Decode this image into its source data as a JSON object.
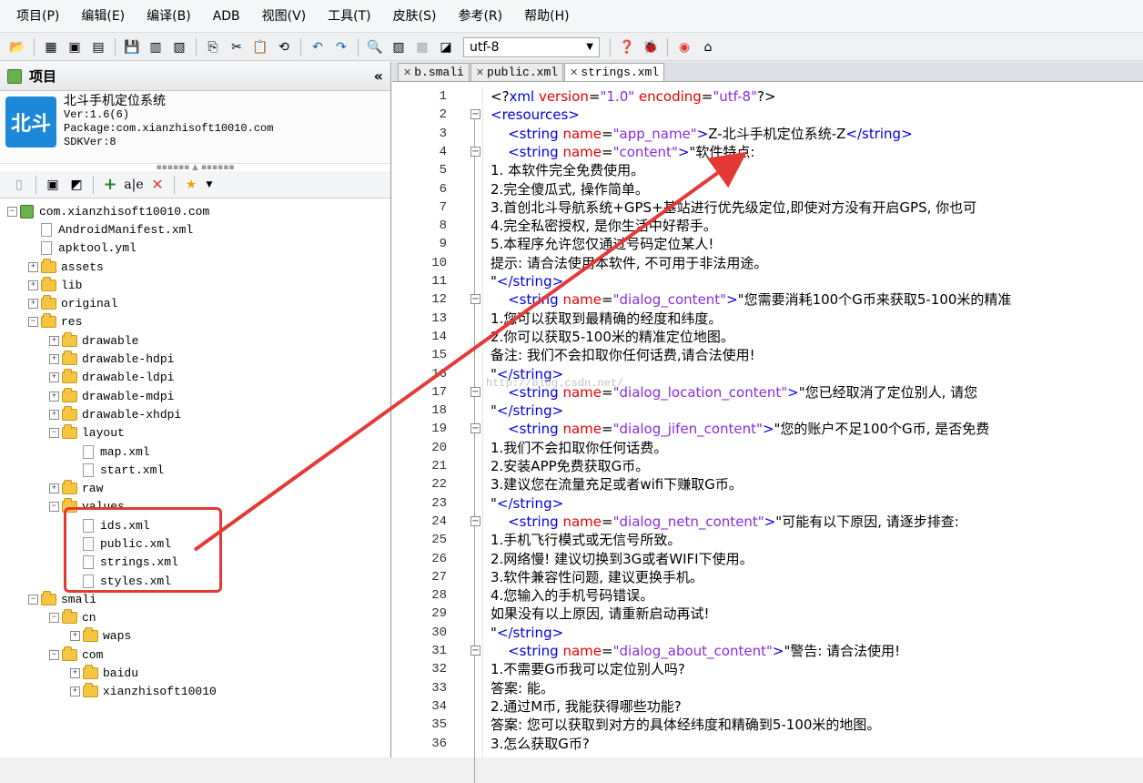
{
  "menu": [
    "项目(P)",
    "编辑(E)",
    "编译(B)",
    "ADB",
    "视图(V)",
    "工具(T)",
    "皮肤(S)",
    "参考(R)",
    "帮助(H)"
  ],
  "toolbar": {
    "encoding": "utf-8"
  },
  "project_panel": {
    "title": "项目",
    "collapse": "«",
    "logo_text": "北斗",
    "app_name": "北斗手机定位系统",
    "version": "Ver:1.6(6)",
    "package": "Package:com.xianzhisoft10010.com",
    "sdk": "SDKVer:8"
  },
  "tree": [
    {
      "label": "com.xianzhisoft10010.com",
      "type": "project",
      "indent": 0,
      "exp": "-"
    },
    {
      "label": "AndroidManifest.xml",
      "type": "file",
      "indent": 1,
      "exp": ""
    },
    {
      "label": "apktool.yml",
      "type": "file",
      "indent": 1,
      "exp": ""
    },
    {
      "label": "assets",
      "type": "folder",
      "indent": 1,
      "exp": "+"
    },
    {
      "label": "lib",
      "type": "folder",
      "indent": 1,
      "exp": "+"
    },
    {
      "label": "original",
      "type": "folder",
      "indent": 1,
      "exp": "+"
    },
    {
      "label": "res",
      "type": "folder",
      "indent": 1,
      "exp": "-"
    },
    {
      "label": "drawable",
      "type": "folder",
      "indent": 2,
      "exp": "+"
    },
    {
      "label": "drawable-hdpi",
      "type": "folder",
      "indent": 2,
      "exp": "+"
    },
    {
      "label": "drawable-ldpi",
      "type": "folder",
      "indent": 2,
      "exp": "+"
    },
    {
      "label": "drawable-mdpi",
      "type": "folder",
      "indent": 2,
      "exp": "+"
    },
    {
      "label": "drawable-xhdpi",
      "type": "folder",
      "indent": 2,
      "exp": "+"
    },
    {
      "label": "layout",
      "type": "folder",
      "indent": 2,
      "exp": "-"
    },
    {
      "label": "map.xml",
      "type": "file",
      "indent": 3,
      "exp": ""
    },
    {
      "label": "start.xml",
      "type": "file",
      "indent": 3,
      "exp": ""
    },
    {
      "label": "raw",
      "type": "folder",
      "indent": 2,
      "exp": "+"
    },
    {
      "label": "values",
      "type": "folder",
      "indent": 2,
      "exp": "-"
    },
    {
      "label": "ids.xml",
      "type": "file",
      "indent": 3,
      "exp": ""
    },
    {
      "label": "public.xml",
      "type": "file",
      "indent": 3,
      "exp": ""
    },
    {
      "label": "strings.xml",
      "type": "file",
      "indent": 3,
      "exp": ""
    },
    {
      "label": "styles.xml",
      "type": "file",
      "indent": 3,
      "exp": ""
    },
    {
      "label": "smali",
      "type": "folder",
      "indent": 1,
      "exp": "-"
    },
    {
      "label": "cn",
      "type": "folder",
      "indent": 2,
      "exp": "-"
    },
    {
      "label": "waps",
      "type": "folder",
      "indent": 3,
      "exp": "+"
    },
    {
      "label": "com",
      "type": "folder",
      "indent": 2,
      "exp": "-"
    },
    {
      "label": "baidu",
      "type": "folder",
      "indent": 3,
      "exp": "+"
    },
    {
      "label": "xianzhisoft10010",
      "type": "folder",
      "indent": 3,
      "exp": "+"
    }
  ],
  "tabs": [
    "b.smali",
    "public.xml",
    "strings.xml"
  ],
  "watermark": "http://blog.csdn.net/",
  "code_lines": [
    [
      [
        "",
        "<?"
      ],
      [
        "tag",
        "xml"
      ],
      [
        "attr",
        " version"
      ],
      [
        "",
        "="
      ],
      [
        "val",
        "\"1.0\""
      ],
      [
        "attr",
        " encoding"
      ],
      [
        "",
        "="
      ],
      [
        "val",
        "\"utf-8\""
      ],
      [
        "",
        "?>"
      ]
    ],
    [
      [
        "tag",
        "<resources>"
      ]
    ],
    [
      [
        "",
        "    "
      ],
      [
        "tag",
        "<string"
      ],
      [
        "attr",
        " name"
      ],
      [
        "",
        "="
      ],
      [
        "val",
        "\"app_name\""
      ],
      [
        "tag",
        ">"
      ],
      [
        "",
        "Z-北斗手机定位系统-Z"
      ],
      [
        "tag",
        "</string>"
      ]
    ],
    [
      [
        "",
        "    "
      ],
      [
        "tag",
        "<string"
      ],
      [
        "attr",
        " name"
      ],
      [
        "",
        "="
      ],
      [
        "val",
        "\"content\""
      ],
      [
        "tag",
        ">"
      ],
      [
        "",
        "\"软件特点:"
      ]
    ],
    [
      [
        "",
        "1. 本软件完全免费使用。"
      ]
    ],
    [
      [
        "",
        "2.完全傻瓜式, 操作简单。"
      ]
    ],
    [
      [
        "",
        "3.首创北斗导航系统+GPS+基站进行优先级定位,即使对方没有开启GPS, 你也可"
      ]
    ],
    [
      [
        "",
        "4.完全私密授权, 是你生活中好帮手。"
      ]
    ],
    [
      [
        "",
        "5.本程序允许您仅通过号码定位某人!"
      ]
    ],
    [
      [
        "",
        "提示: 请合法使用本软件, 不可用于非法用途。"
      ]
    ],
    [
      [
        "",
        "\""
      ],
      [
        "tag",
        "</string>"
      ]
    ],
    [
      [
        "",
        "    "
      ],
      [
        "tag",
        "<string"
      ],
      [
        "attr",
        " name"
      ],
      [
        "",
        "="
      ],
      [
        "val",
        "\"dialog_content\""
      ],
      [
        "tag",
        ">"
      ],
      [
        "",
        "\"您需要消耗100个G币来获取5-100米的精准"
      ]
    ],
    [
      [
        "",
        "1.您可以获取到最精确的经度和纬度。"
      ]
    ],
    [
      [
        "",
        "2.你可以获取5-100米的精准定位地图。"
      ]
    ],
    [
      [
        "",
        "备注: 我们不会扣取你任何话费,请合法使用!"
      ]
    ],
    [
      [
        "",
        "\""
      ],
      [
        "tag",
        "</string>"
      ]
    ],
    [
      [
        "",
        "    "
      ],
      [
        "tag",
        "<string"
      ],
      [
        "attr",
        " name"
      ],
      [
        "",
        "="
      ],
      [
        "val",
        "\"dialog_location_content\""
      ],
      [
        "tag",
        ">"
      ],
      [
        "",
        "\"您已经取消了定位别人, 请您"
      ]
    ],
    [
      [
        "",
        "\""
      ],
      [
        "tag",
        "</string>"
      ]
    ],
    [
      [
        "",
        "    "
      ],
      [
        "tag",
        "<string"
      ],
      [
        "attr",
        " name"
      ],
      [
        "",
        "="
      ],
      [
        "val",
        "\"dialog_jifen_content\""
      ],
      [
        "tag",
        ">"
      ],
      [
        "",
        "\"您的账户不足100个G币, 是否免费"
      ]
    ],
    [
      [
        "",
        "1.我们不会扣取你任何话费。"
      ]
    ],
    [
      [
        "",
        "2.安装APP免费获取G币。"
      ]
    ],
    [
      [
        "",
        "3.建议您在流量充足或者wifi下赚取G币。"
      ]
    ],
    [
      [
        "",
        "\""
      ],
      [
        "tag",
        "</string>"
      ]
    ],
    [
      [
        "",
        "    "
      ],
      [
        "tag",
        "<string"
      ],
      [
        "attr",
        " name"
      ],
      [
        "",
        "="
      ],
      [
        "val",
        "\"dialog_netn_content\""
      ],
      [
        "tag",
        ">"
      ],
      [
        "",
        "\"可能有以下原因, 请逐步排查:"
      ]
    ],
    [
      [
        "",
        "1.手机飞行模式或无信号所致。"
      ]
    ],
    [
      [
        "",
        "2.网络慢! 建议切换到3G或者WIFI下使用。"
      ]
    ],
    [
      [
        "",
        "3.软件兼容性问题, 建议更换手机。"
      ]
    ],
    [
      [
        "",
        "4.您输入的手机号码错误。"
      ]
    ],
    [
      [
        "",
        "如果没有以上原因, 请重新启动再试!"
      ]
    ],
    [
      [
        "",
        "\""
      ],
      [
        "tag",
        "</string>"
      ]
    ],
    [
      [
        "",
        "    "
      ],
      [
        "tag",
        "<string"
      ],
      [
        "attr",
        " name"
      ],
      [
        "",
        "="
      ],
      [
        "val",
        "\"dialog_about_content\""
      ],
      [
        "tag",
        ">"
      ],
      [
        "",
        "\"警告: 请合法使用!"
      ]
    ],
    [
      [
        "",
        "1.不需要G币我可以定位别人吗?"
      ]
    ],
    [
      [
        "",
        "答案: 能。"
      ]
    ],
    [
      [
        "",
        "2.通过M币, 我能获得哪些功能?"
      ]
    ],
    [
      [
        "",
        "答案: 您可以获取到对方的具体经纬度和精确到5-100米的地图。"
      ]
    ],
    [
      [
        "",
        "3.怎么获取G币?"
      ]
    ]
  ],
  "fold_rows": [
    2,
    4,
    12,
    17,
    19,
    24,
    31
  ]
}
